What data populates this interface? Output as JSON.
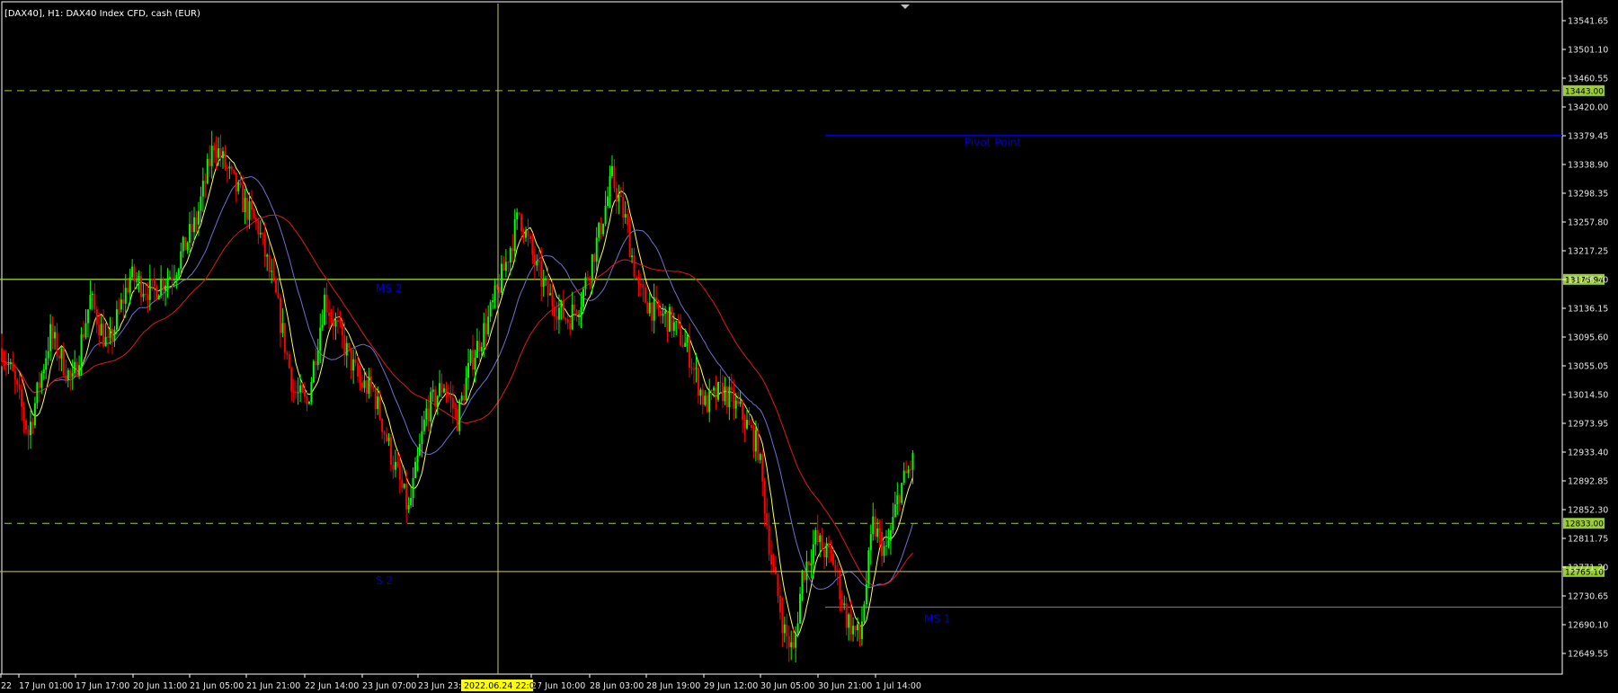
{
  "window": {
    "title": "[DAX40], H1:  DAX40 Index CFD, cash (EUR)"
  },
  "colors": {
    "background": "#000000",
    "bull_candle": "#00ff00",
    "bear_candle": "#ff0000",
    "ma_fast": "#ffff55",
    "ma_mid": "#7070cc",
    "ma_slow": "#dd1a1a",
    "dashed_level": "#9acd32",
    "level_tag": "#9acd32",
    "pivot_line": "#0000cc",
    "level_label": "#0000cc",
    "crosshair": "#c8c860",
    "s2_line": "#c8a000"
  },
  "chart_data": {
    "type": "candlestick",
    "symbol": "DAX40",
    "timeframe": "H1",
    "y_axis": {
      "ylim": [
        12610,
        13570
      ],
      "ticks": [
        "13541.65",
        "13501.10",
        "13460.55",
        "13420.00",
        "13379.45",
        "13338.90",
        "13298.35",
        "13257.80",
        "13217.25",
        "13176.70",
        "13136.15",
        "13095.60",
        "13055.05",
        "13014.50",
        "12973.95",
        "12933.40",
        "12892.85",
        "12852.30",
        "12811.75",
        "12771.20",
        "12730.65",
        "12690.10",
        "12649.55"
      ]
    },
    "x_axis": {
      "labels": [
        "22",
        "17 Jun 01:00",
        "17 Jun 17:00",
        "20 Jun 11:00",
        "21 Jun 05:00",
        "21 Jun 21:00",
        "22 Jun 14:00",
        "23 Jun 07:00",
        "23 Jun 23:00",
        "27 Jun 10:00",
        "28 Jun 03:00",
        "28 Jun 19:00",
        "29 Jun 12:00",
        "30 Jun 05:00",
        "30 Jun 21:00",
        "1 Jul 14:00"
      ],
      "crosshair_label": "2022.06.24 22:00"
    },
    "levels": [
      {
        "name": "dashed-high",
        "value": 13443.0,
        "tag": "13443.00",
        "style": "dashed"
      },
      {
        "name": "ms2",
        "value": 13176.94,
        "tag": "13176.94",
        "label": "MS 2",
        "style": "solid"
      },
      {
        "name": "dashed-low",
        "value": 12833.0,
        "tag": "12833.00",
        "style": "dashed"
      },
      {
        "name": "s2",
        "value": 12765.1,
        "tag": "12765.10",
        "label": "S 2",
        "style": "solid"
      }
    ],
    "pivot": {
      "label": "Pivot Point",
      "value": 13380
    },
    "ms1": {
      "label": "MS 1",
      "value": 12715
    },
    "keypoints": [
      [
        0,
        13080
      ],
      [
        5,
        13040
      ],
      [
        12,
        12960
      ],
      [
        22,
        13100
      ],
      [
        32,
        13030
      ],
      [
        40,
        13150
      ],
      [
        48,
        13080
      ],
      [
        58,
        13180
      ],
      [
        68,
        13160
      ],
      [
        78,
        13190
      ],
      [
        88,
        13260
      ],
      [
        96,
        13370
      ],
      [
        102,
        13330
      ],
      [
        110,
        13280
      ],
      [
        116,
        13250
      ],
      [
        124,
        13150
      ],
      [
        132,
        13020
      ],
      [
        138,
        13000
      ],
      [
        146,
        13150
      ],
      [
        154,
        13090
      ],
      [
        162,
        13030
      ],
      [
        168,
        13020
      ],
      [
        176,
        12930
      ],
      [
        184,
        12850
      ],
      [
        192,
        12990
      ],
      [
        200,
        13030
      ],
      [
        206,
        12980
      ],
      [
        212,
        13060
      ],
      [
        220,
        13120
      ],
      [
        228,
        13200
      ],
      [
        234,
        13270
      ],
      [
        242,
        13190
      ],
      [
        248,
        13150
      ],
      [
        256,
        13120
      ],
      [
        262,
        13150
      ],
      [
        270,
        13240
      ],
      [
        276,
        13320
      ],
      [
        282,
        13260
      ],
      [
        288,
        13160
      ],
      [
        296,
        13130
      ],
      [
        302,
        13120
      ],
      [
        310,
        13080
      ],
      [
        318,
        13000
      ],
      [
        326,
        13020
      ],
      [
        334,
        12990
      ],
      [
        342,
        12940
      ],
      [
        348,
        12780
      ],
      [
        354,
        12680
      ],
      [
        358,
        12650
      ],
      [
        362,
        12760
      ],
      [
        368,
        12810
      ],
      [
        376,
        12780
      ],
      [
        382,
        12700
      ],
      [
        388,
        12670
      ],
      [
        394,
        12830
      ],
      [
        400,
        12790
      ],
      [
        406,
        12880
      ],
      [
        412,
        12920
      ]
    ]
  },
  "labels_text": {
    "ms2": "MS 2",
    "s2": "S 2",
    "ms1": "MS 1",
    "pivot": "Pivot Point"
  }
}
